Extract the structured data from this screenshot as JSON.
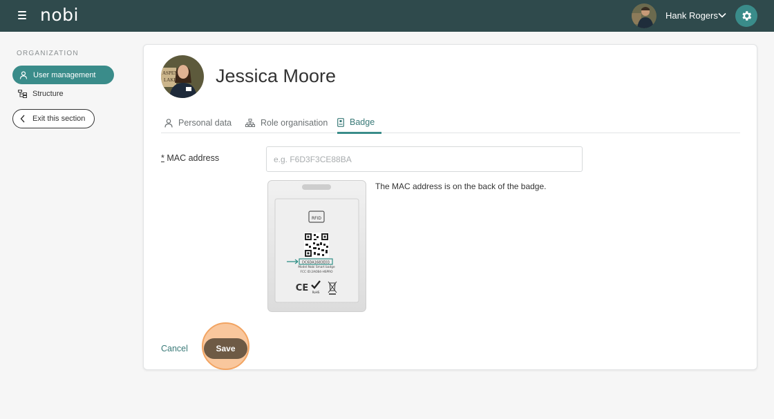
{
  "header": {
    "logo": "nobi",
    "user_name": "Hank Rogers",
    "icons": {
      "menu": "hamburger-icon",
      "chevron": "chevron-down-icon",
      "settings": "gear-icon"
    },
    "colors": {
      "bar": "#2f4a4c",
      "accent": "#3a8c8a"
    }
  },
  "sidebar": {
    "section_title": "ORGANIZATION",
    "items": [
      {
        "label": "User management",
        "icon": "user-icon",
        "active": true
      },
      {
        "label": "Structure",
        "icon": "structure-icon",
        "active": false
      }
    ],
    "exit_label": "Exit this section"
  },
  "profile": {
    "name": "Jessica Moore",
    "tabs": [
      {
        "label": "Personal data",
        "icon": "person-icon"
      },
      {
        "label": "Role organisation",
        "icon": "hierarchy-icon"
      },
      {
        "label": "Badge",
        "icon": "badge-icon",
        "active": true
      }
    ]
  },
  "form": {
    "mac_required_mark": "*",
    "mac_label": "MAC address",
    "mac_value": "",
    "mac_placeholder": "e.g. F6D3F3CE88BA",
    "hint": "The MAC address is on the back of the badge.",
    "badge_image": {
      "rfid": "RFID",
      "mac_sample": "DC6DA1683E03",
      "model": "Model:Nobi Smart badge",
      "fcc": "FCC ID:2AOB4-HSPRO",
      "marks": [
        "CE",
        "RoHS"
      ]
    }
  },
  "actions": {
    "cancel": "Cancel",
    "save": "Save"
  }
}
